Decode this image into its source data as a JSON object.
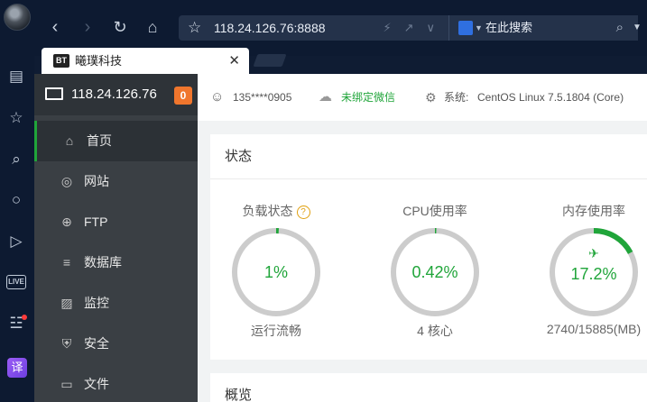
{
  "browser": {
    "address": "118.24.126.76:8888",
    "search_placeholder": "在此搜索",
    "tab_title": "曦璞科技",
    "tab_favicon": "BT"
  },
  "sidebar": {
    "host": "118.24.126.76",
    "badge": "0",
    "items": [
      {
        "label": "首页",
        "icon": "home-icon",
        "active": true
      },
      {
        "label": "网站",
        "icon": "globe-icon"
      },
      {
        "label": "FTP",
        "icon": "ftp-icon"
      },
      {
        "label": "数据库",
        "icon": "database-icon"
      },
      {
        "label": "监控",
        "icon": "monitor-chart-icon"
      },
      {
        "label": "安全",
        "icon": "shield-icon"
      },
      {
        "label": "文件",
        "icon": "folder-icon"
      }
    ]
  },
  "info": {
    "user": "135****0905",
    "wechat": "未绑定微信",
    "system_label": "系统:",
    "system_value": "CentOS Linux 7.5.1804 (Core)"
  },
  "status": {
    "title": "状态",
    "gauges": [
      {
        "label": "负载状态",
        "value": "1%",
        "fraction": 0.01,
        "sub": "运行流畅",
        "has_help": true
      },
      {
        "label": "CPU使用率",
        "value": "0.42%",
        "fraction": 0.0042,
        "sub": "4 核心"
      },
      {
        "label": "内存使用率",
        "value": "17.2%",
        "fraction": 0.172,
        "sub": "2740/15885(MB)",
        "has_rocket": true
      }
    ]
  },
  "overview": {
    "title": "概览"
  },
  "colors": {
    "accent": "#20a53a",
    "badge": "#f0762d",
    "sidebar": "#3a3f44"
  }
}
